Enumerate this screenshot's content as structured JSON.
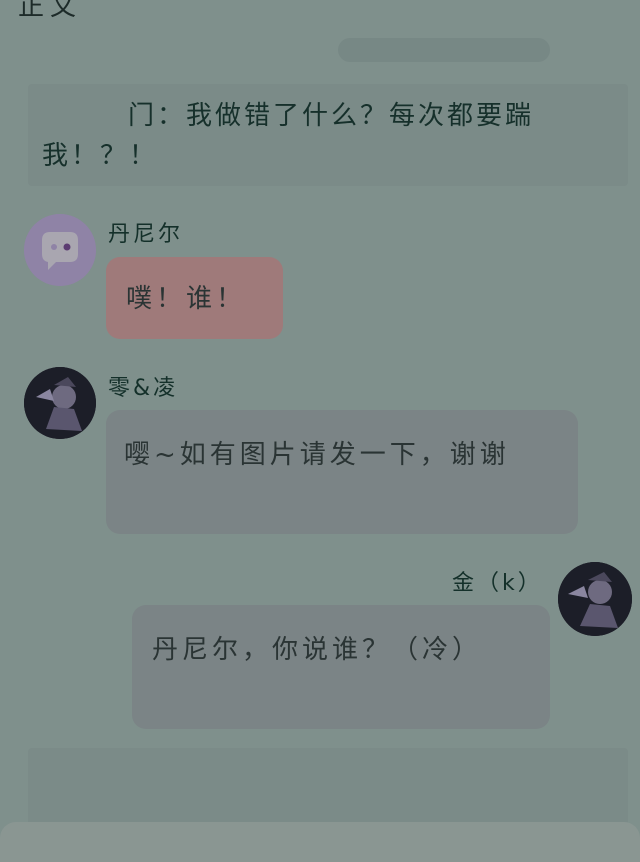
{
  "top": {
    "title_fragment": "正文"
  },
  "narration": {
    "text": "门：我做错了什么？每次都要踹我！？！"
  },
  "messages": [
    {
      "sender": "丹尼尔",
      "text": "噗！谁！",
      "bubble_color": "#9f7a7a"
    },
    {
      "sender": "零&凌",
      "text": "嘤~如有图片请发一下，谢谢",
      "bubble_color": "#7b8486"
    },
    {
      "sender": "金（k）",
      "text": "丹尼尔，你说谁？（冷）",
      "bubble_color": "#7b8486"
    }
  ],
  "icons": {
    "danny_avatar": "chat-bubble-avatar-icon",
    "ling_avatar": "anime-character-avatar",
    "kim_avatar": "anime-character-avatar"
  }
}
